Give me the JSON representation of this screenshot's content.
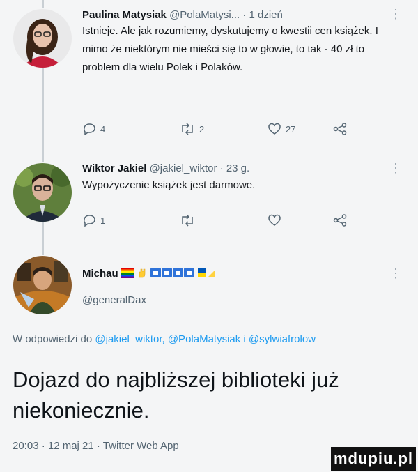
{
  "tweets": [
    {
      "display_name": "Paulina Matysiak",
      "handle": "@PolaMatysi...",
      "time": "· 1 dzień",
      "text": "Istnieje. Ale jak rozumiemy, dyskutujemy o kwestii cen książek. I mimo że niektórym nie mieści się to w głowie, to tak - 40 zł to problem dla wielu Polek i Polaków.",
      "reply_count": "4",
      "retweet_count": "2",
      "like_count": "27"
    },
    {
      "display_name": "Wiktor Jakiel",
      "handle": "@jakiel_wiktor",
      "time": "· 23 g.",
      "text": "Wypożyczenie książek jest darmowe.",
      "reply_count": "1",
      "retweet_count": "",
      "like_count": ""
    }
  ],
  "main_tweet": {
    "display_name": "Michau",
    "handle": "@generalDax",
    "reply_prefix": "W odpowiedzi do",
    "reply_mentions": "@jakiel_wiktor, @PolaMatysiak i @sylwiafrolow",
    "text": "Dojazd do najbliższej biblioteki już niekoniecznie.",
    "timestamp": "20:03 · 12 maj 21 · Twitter Web App"
  },
  "watermark": "mdupiu.pl",
  "colors": {
    "background": "#f4f5f6",
    "link": "#1d9bf0",
    "secondary_text": "#536471",
    "thread_line": "#c9cfd4"
  }
}
